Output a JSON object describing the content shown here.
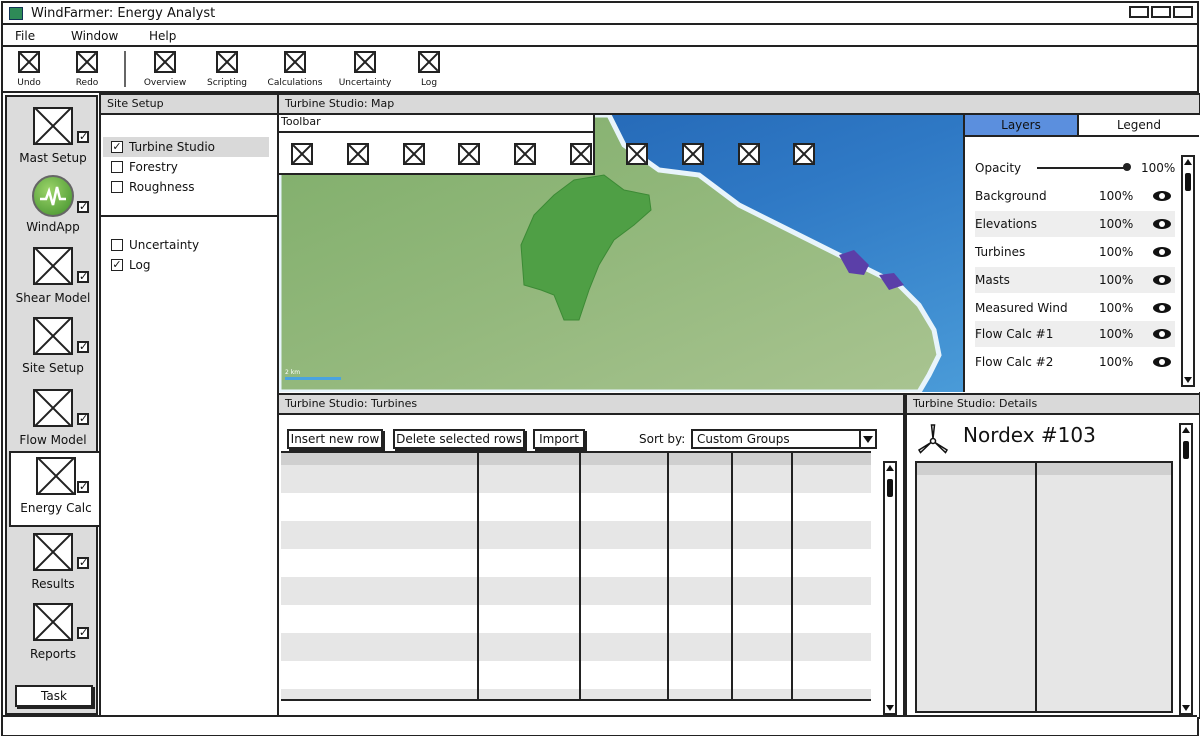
{
  "window": {
    "title": "WindFarmer: Energy Analyst"
  },
  "menu": [
    "File",
    "Window",
    "Help"
  ],
  "toolbar": [
    "Undo",
    "Redo",
    "Overview",
    "Scripting",
    "Calculations",
    "Uncertainty",
    "Log"
  ],
  "nav": {
    "items": [
      {
        "label": "Mast Setup",
        "checked": true
      },
      {
        "label": "WindApp",
        "checked": true
      },
      {
        "label": "Shear Model",
        "checked": true
      },
      {
        "label": "Site Setup",
        "checked": true
      },
      {
        "label": "Flow Model",
        "checked": true
      },
      {
        "label": "Energy Calc",
        "checked": true,
        "active": true
      },
      {
        "label": "Results",
        "checked": true
      },
      {
        "label": "Reports",
        "checked": true
      }
    ],
    "task_label": "Task"
  },
  "site_setup": {
    "title": "Site Setup",
    "group1": [
      {
        "label": "Turbine Studio",
        "checked": true,
        "selected": true
      },
      {
        "label": "Forestry",
        "checked": false
      },
      {
        "label": "Roughness",
        "checked": false
      }
    ],
    "group2": [
      {
        "label": "Uncertainty",
        "checked": false
      },
      {
        "label": "Log",
        "checked": true
      }
    ]
  },
  "map_panel": {
    "title": "Turbine Studio: Map",
    "toolbar_label": "Toolbar",
    "scale_label": "2 km",
    "tabs": [
      "Layers",
      "Legend"
    ],
    "active_tab": "Layers",
    "opacity": {
      "label": "Opacity",
      "value": "100%"
    },
    "layers": [
      {
        "name": "Background",
        "value": "100%"
      },
      {
        "name": "Elevations",
        "value": "100%"
      },
      {
        "name": "Turbines",
        "value": "100%"
      },
      {
        "name": "Masts",
        "value": "100%"
      },
      {
        "name": "Measured Wind",
        "value": "100%"
      },
      {
        "name": "Flow Calc #1",
        "value": "100%"
      },
      {
        "name": "Flow Calc #2",
        "value": "100%"
      }
    ]
  },
  "turbines_panel": {
    "title": "Turbine Studio: Turbines",
    "insert_label": "Insert new row",
    "delete_label": "Delete selected rows",
    "import_label": "Import",
    "sort_label": "Sort by:",
    "sort_value": "Custom Groups"
  },
  "details_panel": {
    "title": "Turbine Studio: Details",
    "turbine_name": "Nordex #103"
  },
  "colors": {
    "accent_tab": "#5b8fde",
    "site_green": "#4f9f45",
    "sea": "#2f79c5"
  }
}
